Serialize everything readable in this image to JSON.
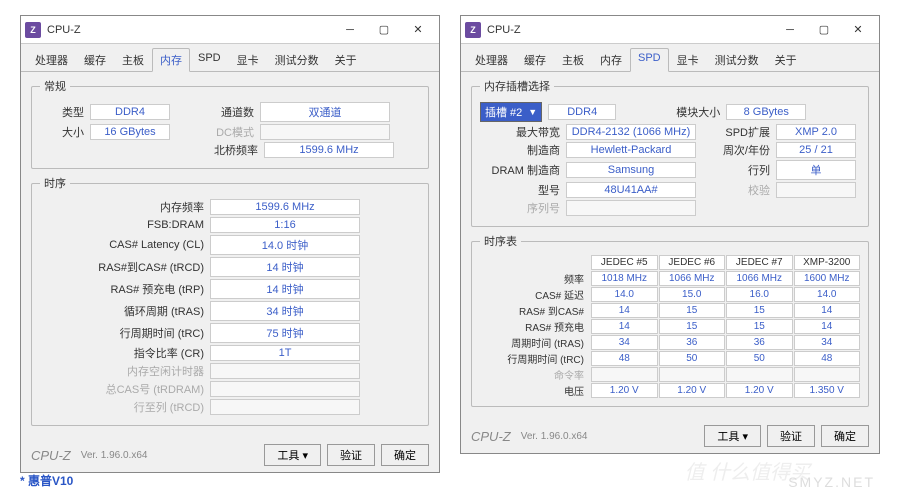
{
  "app_title": "CPU-Z",
  "tabs": [
    "处理器",
    "缓存",
    "主板",
    "内存",
    "SPD",
    "显卡",
    "测试分数",
    "关于"
  ],
  "footer": {
    "brand": "CPU-Z",
    "version": "Ver. 1.96.0.x64",
    "tools": "工具",
    "validate": "验证",
    "ok": "确定"
  },
  "left": {
    "active_tab": "内存",
    "general": {
      "legend": "常规",
      "type_lbl": "类型",
      "type_val": "DDR4",
      "size_lbl": "大小",
      "size_val": "16 GBytes",
      "channels_lbl": "通道数",
      "channels_val": "双通道",
      "dc_lbl": "DC模式",
      "dc_val": "",
      "nb_lbl": "北桥频率",
      "nb_val": "1599.6 MHz"
    },
    "timings": {
      "legend": "时序",
      "rows": [
        {
          "lbl": "内存频率",
          "val": "1599.6 MHz",
          "disabled": false
        },
        {
          "lbl": "FSB:DRAM",
          "val": "1:16",
          "disabled": false
        },
        {
          "lbl": "CAS# Latency (CL)",
          "val": "14.0 时钟",
          "disabled": false
        },
        {
          "lbl": "RAS#到CAS# (tRCD)",
          "val": "14 时钟",
          "disabled": false
        },
        {
          "lbl": "RAS# 预充电 (tRP)",
          "val": "14 时钟",
          "disabled": false
        },
        {
          "lbl": "循环周期 (tRAS)",
          "val": "34 时钟",
          "disabled": false
        },
        {
          "lbl": "行周期时间 (tRC)",
          "val": "75 时钟",
          "disabled": false
        },
        {
          "lbl": "指令比率 (CR)",
          "val": "1T",
          "disabled": false
        },
        {
          "lbl": "内存空闲计时器",
          "val": "",
          "disabled": true
        },
        {
          "lbl": "总CAS号 (tRDRAM)",
          "val": "",
          "disabled": true
        },
        {
          "lbl": "行至列 (tRCD)",
          "val": "",
          "disabled": true
        }
      ]
    }
  },
  "right": {
    "active_tab": "SPD",
    "slot": {
      "legend": "内存插槽选择",
      "slot_label": "插槽 #2",
      "type_val": "DDR4",
      "rows_left": [
        {
          "lbl": "最大带宽",
          "val": "DDR4-2132 (1066 MHz)"
        },
        {
          "lbl": "制造商",
          "val": "Hewlett-Packard"
        },
        {
          "lbl": "DRAM 制造商",
          "val": "Samsung"
        },
        {
          "lbl": "型号",
          "val": "48U41AA#"
        },
        {
          "lbl": "序列号",
          "val": "",
          "disabled": true
        }
      ],
      "rows_right": [
        {
          "lbl": "模块大小",
          "val": "8 GBytes"
        },
        {
          "lbl": "SPD扩展",
          "val": "XMP 2.0"
        },
        {
          "lbl": "周次/年份",
          "val": "25 / 21"
        },
        {
          "lbl": "行列",
          "val": "单"
        },
        {
          "lbl": "校验",
          "val": "",
          "disabled": true
        }
      ]
    },
    "table": {
      "legend": "时序表",
      "cols": [
        "JEDEC #5",
        "JEDEC #6",
        "JEDEC #7",
        "XMP-3200"
      ],
      "rows": [
        {
          "lbl": "频率",
          "vals": [
            "1018 MHz",
            "1066 MHz",
            "1066 MHz",
            "1600 MHz"
          ]
        },
        {
          "lbl": "CAS# 延迟",
          "vals": [
            "14.0",
            "15.0",
            "16.0",
            "14.0"
          ]
        },
        {
          "lbl": "RAS# 到CAS#",
          "vals": [
            "14",
            "15",
            "15",
            "14"
          ]
        },
        {
          "lbl": "RAS# 预充电",
          "vals": [
            "14",
            "15",
            "15",
            "14"
          ]
        },
        {
          "lbl": "周期时间 (tRAS)",
          "vals": [
            "34",
            "36",
            "36",
            "34"
          ]
        },
        {
          "lbl": "行周期时间 (tRC)",
          "vals": [
            "48",
            "50",
            "50",
            "48"
          ]
        },
        {
          "lbl": "命令率",
          "vals": [
            "",
            "",
            "",
            ""
          ],
          "disabled": true
        },
        {
          "lbl": "电压",
          "vals": [
            "1.20 V",
            "1.20 V",
            "1.20 V",
            "1.350 V"
          ]
        }
      ]
    }
  },
  "caption": "* 惠普V10",
  "watermark": "SMYZ.NET",
  "zhidemai": "值 什么值得买"
}
